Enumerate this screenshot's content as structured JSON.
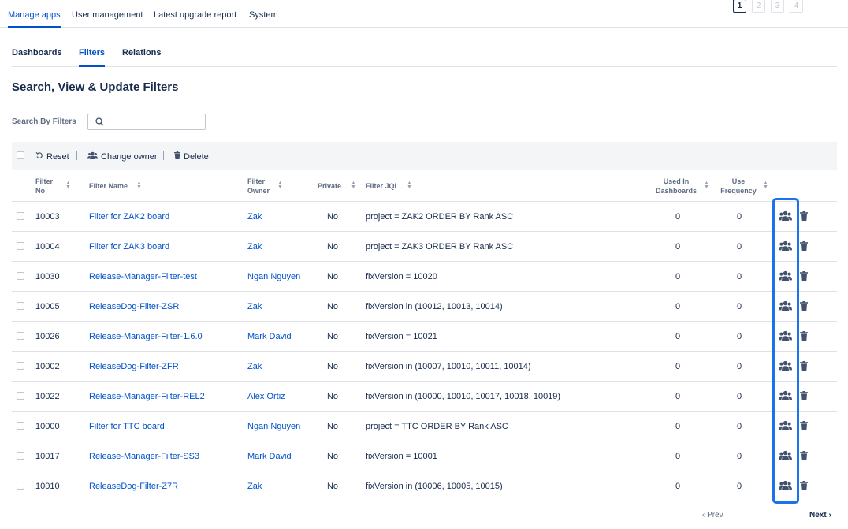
{
  "top_tabs": [
    "Manage apps",
    "User management",
    "Latest upgrade report",
    "System"
  ],
  "sub_tabs": [
    "Dashboards",
    "Filters",
    "Relations"
  ],
  "page_title": "Search, View & Update Filters",
  "search": {
    "label": "Search By Filters",
    "value": ""
  },
  "toolbar": {
    "reset": "Reset",
    "change_owner": "Change owner",
    "delete": "Delete"
  },
  "columns": {
    "filter_no_1": "Filter",
    "filter_no_2": "No",
    "filter_name": "Filter Name",
    "owner_1": "Filter",
    "owner_2": "Owner",
    "private": "Private",
    "jql": "Filter JQL",
    "used_1": "Used In",
    "used_2": "Dashboards",
    "freq_1": "Use",
    "freq_2": "Frequency"
  },
  "rows": [
    {
      "no": "10003",
      "name": "Filter for ZAK2 board",
      "owner": "Zak",
      "private": "No",
      "jql": "project = ZAK2 ORDER BY Rank ASC",
      "used": "0",
      "freq": "0"
    },
    {
      "no": "10004",
      "name": "Filter for ZAK3 board",
      "owner": "Zak",
      "private": "No",
      "jql": "project = ZAK3 ORDER BY Rank ASC",
      "used": "0",
      "freq": "0"
    },
    {
      "no": "10030",
      "name": "Release-Manager-Filter-test",
      "owner": "Ngan Nguyen",
      "private": "No",
      "jql": "fixVersion = 10020",
      "used": "0",
      "freq": "0"
    },
    {
      "no": "10005",
      "name": "ReleaseDog-Filter-ZSR",
      "owner": "Zak",
      "private": "No",
      "jql": "fixVersion in (10012, 10013, 10014)",
      "used": "0",
      "freq": "0"
    },
    {
      "no": "10026",
      "name": "Release-Manager-Filter-1.6.0",
      "owner": "Mark David",
      "private": "No",
      "jql": "fixVersion = 10021",
      "used": "0",
      "freq": "0"
    },
    {
      "no": "10002",
      "name": "ReleaseDog-Filter-ZFR",
      "owner": "Zak",
      "private": "No",
      "jql": "fixVersion in (10007, 10010, 10011, 10014)",
      "used": "0",
      "freq": "0"
    },
    {
      "no": "10022",
      "name": "Release-Manager-Filter-REL2",
      "owner": "Alex Ortiz",
      "private": "No",
      "jql": "fixVersion in (10000, 10010, 10017, 10018, 10019)",
      "used": "0",
      "freq": "0"
    },
    {
      "no": "10000",
      "name": "Filter for TTC board",
      "owner": "Ngan Nguyen",
      "private": "No",
      "jql": "project = TTC ORDER BY Rank ASC",
      "used": "0",
      "freq": "0"
    },
    {
      "no": "10017",
      "name": "Release-Manager-Filter-SS3",
      "owner": "Mark David",
      "private": "No",
      "jql": "fixVersion = 10001",
      "used": "0",
      "freq": "0"
    },
    {
      "no": "10010",
      "name": "ReleaseDog-Filter-Z7R",
      "owner": "Zak",
      "private": "No",
      "jql": "fixVersion in (10006, 10005, 10015)",
      "used": "0",
      "freq": "0"
    }
  ],
  "pagination": {
    "prev": "Prev",
    "next": "Next",
    "pages": [
      "1",
      "2",
      "3",
      "4"
    ],
    "current": "1"
  },
  "colors": {
    "accent": "#0052cc",
    "highlight": "#1a73e8"
  }
}
